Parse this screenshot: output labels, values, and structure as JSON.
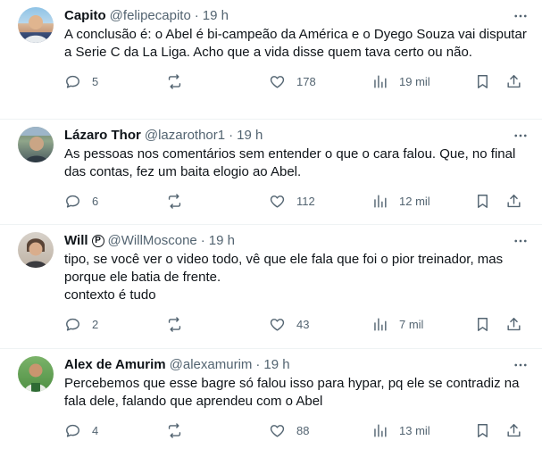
{
  "tweets": [
    {
      "name": "Capito",
      "handle": "@felipecapito",
      "separator": "·",
      "time": "19 h",
      "verified_badge": "",
      "text": "A conclusão é: o Abel é bi-campeão da América e o Dyego Souza vai disputar a Serie C da La Liga. Acho que a vida disse quem tava certo ou não.",
      "replies": "5",
      "retweets": "",
      "likes": "178",
      "views": "19 mil"
    },
    {
      "name": "Lázaro Thor",
      "handle": "@lazarothor1",
      "separator": "·",
      "time": "19 h",
      "verified_badge": "",
      "text": "As pessoas nos comentários sem entender o que o cara falou. Que, no final das contas, fez um baita elogio ao Abel.",
      "replies": "6",
      "retweets": "",
      "likes": "112",
      "views": "12 mil"
    },
    {
      "name": "Will",
      "handle": "@WillMoscone",
      "separator": "·",
      "time": "19 h",
      "verified_badge": "P",
      "text": "tipo, se você ver o video todo, vê que ele fala que foi o pior treinador, mas porque ele batia de frente.\ncontexto é tudo",
      "replies": "2",
      "retweets": "",
      "likes": "43",
      "views": "7 mil"
    },
    {
      "name": "Alex de Amurim",
      "handle": "@alexamurim",
      "separator": "·",
      "time": "19 h",
      "verified_badge": "",
      "text": "Percebemos que esse bagre só falou isso para hypar, pq ele se contradiz na fala dele, falando que aprendeu com o Abel",
      "replies": "4",
      "retweets": "",
      "likes": "88",
      "views": "13 mil"
    }
  ],
  "icons": {
    "more": "more-horizontal-icon",
    "reply": "reply-icon",
    "retweet": "retweet-icon",
    "like": "heart-icon",
    "views": "bar-chart-icon",
    "bookmark": "bookmark-icon",
    "share": "share-icon"
  },
  "colors": {
    "text": "#0f1419",
    "secondary": "#536471",
    "divider": "#eff3f4",
    "background": "#ffffff"
  }
}
